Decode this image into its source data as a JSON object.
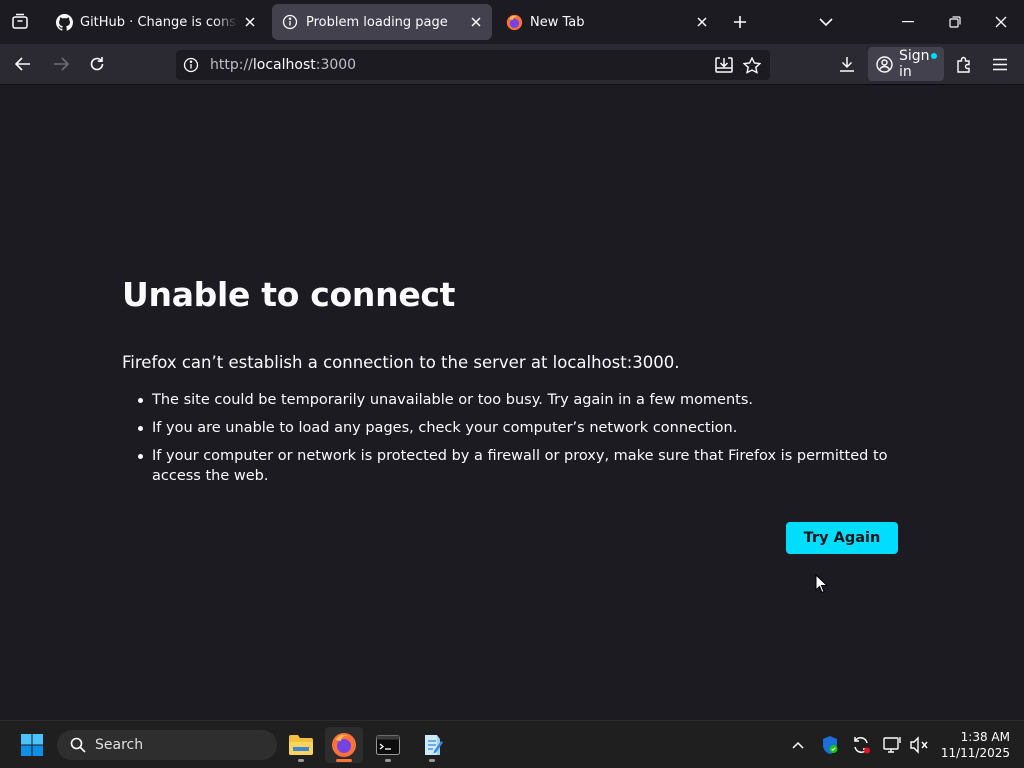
{
  "browser": {
    "tabs": [
      {
        "title": "GitHub · Change is constant. GitHub keeps you ahead.",
        "active": false
      },
      {
        "title": "Problem loading page",
        "active": true
      },
      {
        "title": "New Tab",
        "active": false
      }
    ],
    "url": {
      "scheme": "http://",
      "host": "localhost",
      "rest": ":3000"
    },
    "sign_in_label": "Sign in"
  },
  "error_page": {
    "title": "Unable to connect",
    "description": "Firefox can’t establish a connection to the server at localhost:3000.",
    "reasons": [
      "The site could be temporarily unavailable or too busy. Try again in a few moments.",
      "If you are unable to load any pages, check your computer’s network connection.",
      "If your computer or network is protected by a firewall or proxy, make sure that Firefox is permitted to access the web."
    ],
    "try_again_label": "Try Again"
  },
  "taskbar": {
    "search_placeholder": "Search",
    "time": "1:38 AM",
    "date": "11/11/2025"
  },
  "colors": {
    "accent": "#00ddff",
    "tab_bar": "#1c1b22",
    "nav_bar": "#2b2a33",
    "active_tab": "#42414d",
    "taskbar": "#1f1f1f"
  }
}
